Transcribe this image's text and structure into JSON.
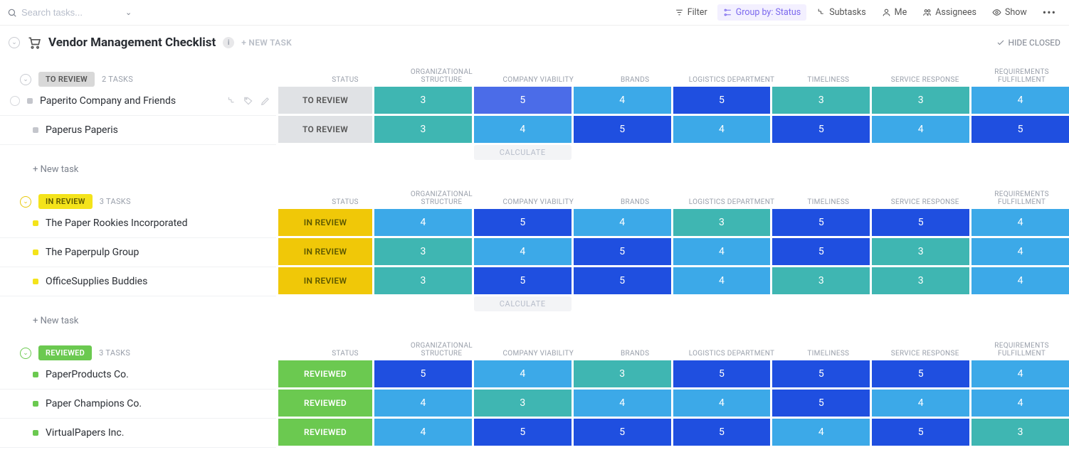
{
  "search": {
    "placeholder": "Search tasks..."
  },
  "toolbar": {
    "filter": "Filter",
    "groupby": "Group by: Status",
    "subtasks": "Subtasks",
    "me": "Me",
    "assignees": "Assignees",
    "show": "Show"
  },
  "list": {
    "title": "Vendor Management Checklist",
    "new_task": "+ NEW TASK",
    "hide_closed": "HIDE CLOSED"
  },
  "columns": [
    "STATUS",
    "ORGANIZATIONAL STRUCTURE",
    "COMPANY VIABILITY",
    "BRANDS",
    "LOGISTICS DEPARTMENT",
    "TIMELINESS",
    "SERVICE RESPONSE",
    "REQUIREMENTS FULFILLMENT"
  ],
  "groups": [
    {
      "key": "to_review",
      "label": "TO REVIEW",
      "count_label": "2 TASKS",
      "status_class": "status-toreview",
      "status_cell_class": "sc-toreview",
      "dot_class": "dot-grey",
      "collapse_class": "",
      "status_cell_label": "TO REVIEW",
      "tasks": [
        {
          "name": "Paperito Company and Friends",
          "hover": true,
          "scores": [
            3,
            5,
            4,
            5,
            3,
            3,
            4
          ],
          "variants": [
            "sc3",
            "sc5b",
            "sc4",
            "sc5",
            "sc3",
            "sc3",
            "sc4"
          ]
        },
        {
          "name": "Paperus Paperis",
          "hover": false,
          "scores": [
            3,
            4,
            5,
            4,
            5,
            4,
            5
          ],
          "variants": [
            "sc3",
            "sc4",
            "sc5",
            "sc4",
            "sc5",
            "sc4",
            "sc5"
          ]
        }
      ],
      "new_task_label": "+ New task",
      "calculate_label": "CALCULATE"
    },
    {
      "key": "in_review",
      "label": "IN REVIEW",
      "count_label": "3 TASKS",
      "status_class": "status-inreview",
      "status_cell_class": "sc-inreview",
      "dot_class": "dot-yellow",
      "collapse_class": "yellow",
      "status_cell_label": "IN REVIEW",
      "tasks": [
        {
          "name": "The Paper Rookies Incorporated",
          "hover": false,
          "scores": [
            4,
            5,
            4,
            3,
            5,
            5,
            4
          ],
          "variants": [
            "sc4",
            "sc5",
            "sc4",
            "sc3",
            "sc5",
            "sc5",
            "sc4"
          ]
        },
        {
          "name": "The Paperpulp Group",
          "hover": false,
          "scores": [
            3,
            4,
            5,
            4,
            5,
            3,
            4
          ],
          "variants": [
            "sc3",
            "sc4",
            "sc5",
            "sc4",
            "sc5",
            "sc3",
            "sc4"
          ]
        },
        {
          "name": "OfficeSupplies Buddies",
          "hover": false,
          "scores": [
            3,
            5,
            5,
            4,
            3,
            3,
            4
          ],
          "variants": [
            "sc3",
            "sc5",
            "sc5",
            "sc4",
            "sc3",
            "sc3",
            "sc4"
          ]
        }
      ],
      "new_task_label": "+ New task",
      "calculate_label": "CALCULATE"
    },
    {
      "key": "reviewed",
      "label": "REVIEWED",
      "count_label": "3 TASKS",
      "status_class": "status-reviewed",
      "status_cell_class": "sc-reviewed",
      "dot_class": "dot-green",
      "collapse_class": "green",
      "status_cell_label": "REVIEWED",
      "tasks": [
        {
          "name": "PaperProducts Co.",
          "hover": false,
          "scores": [
            5,
            4,
            3,
            5,
            5,
            5,
            4
          ],
          "variants": [
            "sc5",
            "sc4",
            "sc3",
            "sc5",
            "sc5",
            "sc5",
            "sc4"
          ]
        },
        {
          "name": "Paper Champions Co.",
          "hover": false,
          "scores": [
            4,
            3,
            4,
            4,
            5,
            4,
            4
          ],
          "variants": [
            "sc4",
            "sc3",
            "sc4",
            "sc4",
            "sc5",
            "sc4",
            "sc4"
          ]
        },
        {
          "name": "VirtualPapers Inc.",
          "hover": false,
          "scores": [
            4,
            5,
            5,
            5,
            4,
            5,
            3
          ],
          "variants": [
            "sc4",
            "sc5",
            "sc5",
            "sc5",
            "sc4",
            "sc5",
            "sc3"
          ]
        }
      ]
    }
  ]
}
